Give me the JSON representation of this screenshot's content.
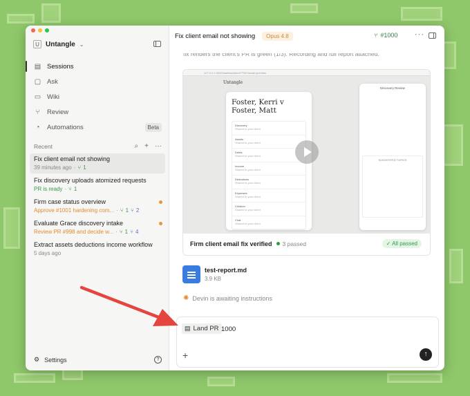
{
  "colors": {
    "background": "#8fc86a",
    "accent_green": "#2f9a4a",
    "accent_orange": "#e38b2c",
    "arrow": "#e5453f"
  },
  "sidebar": {
    "workspace_initial": "U",
    "workspace": "Untangle",
    "nav": [
      {
        "label": "Sessions",
        "icon": "sessions-icon",
        "active": true
      },
      {
        "label": "Ask",
        "icon": "ask-icon"
      },
      {
        "label": "Wiki",
        "icon": "wiki-icon"
      },
      {
        "label": "Review",
        "icon": "review-icon"
      },
      {
        "label": "Automations",
        "icon": "automations-icon",
        "badge": "Beta"
      }
    ],
    "recent_label": "Recent",
    "sessions": [
      {
        "title": "Fix client email not showing",
        "time": "39 minutes ago",
        "pr_count": "1"
      },
      {
        "title": "Fix discovery uploads atomized requests",
        "status": "PR is ready",
        "pr_count": "1"
      },
      {
        "title": "Firm case status overview",
        "status": "Approve #1001 hardening com...",
        "pr_open": "1",
        "pr_merged": "2"
      },
      {
        "title": "Evaluate Grace discovery intake",
        "status": "Review PR #998 and decide w...",
        "pr_open": "1",
        "pr_merged": "4"
      },
      {
        "title": "Extract assets deductions income workflow",
        "time": "5 days ago"
      }
    ],
    "settings_label": "Settings",
    "help_glyph": "?"
  },
  "main": {
    "title": "Fix client email not showing",
    "model": "Opus 4.8",
    "pr_number": "#1000",
    "more_glyph": "···",
    "truncated_text": "fix renders the client's PR is green (1/3). Recording and full report attached.",
    "preview": {
      "url": "127.0.0.1:3000/matters/client/7735?mode=preview",
      "brand": "Untangle",
      "heading": "Foster, Kerri v Foster, Matt",
      "rows": [
        "Discovery",
        "Assets",
        "Debts",
        "Income",
        "Deductions",
        "Expenses",
        "Children",
        "Chat"
      ],
      "row_sub": "Shared to your client",
      "panel_title": "Discovery Review",
      "panel_heading": "SUGGESTED TOPICS"
    },
    "card_title": "Firm client email fix verified",
    "passed": "3 passed",
    "all_passed": "✓ All passed",
    "file": {
      "name": "test-report.md",
      "size": "3.9 KB"
    },
    "awaiting": "Devin is awaiting instructions",
    "composer": {
      "chip": "Land PR",
      "value": "1000",
      "plus": "+",
      "send": "↑"
    }
  }
}
